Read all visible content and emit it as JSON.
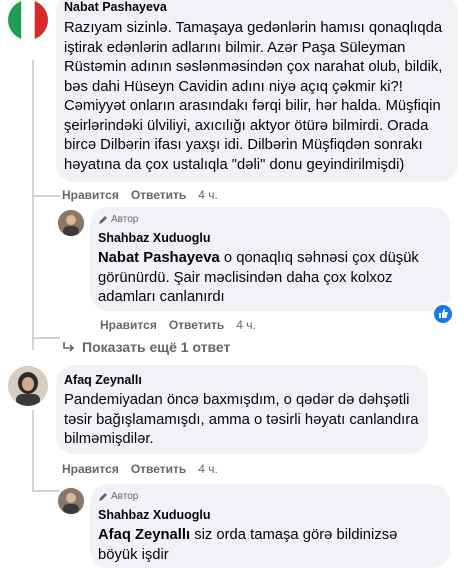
{
  "colors": {
    "bubble": "#f0f2f5",
    "text": "#050505",
    "secondary": "#65676b",
    "like_blue": "#1877f2"
  },
  "comments": [
    {
      "author": "Nabat Pashayeva",
      "text": "Razıyam sizinlə. Tamaşaya gedənlərin hamısı qonaqlıqda iştirak edənlərin adlarını bilmir. Azər Paşa Süleyman Rüstəmin adının səslənməsindən çox narahat olub, bildik, bəs dahi Hüseyn Cavidin adını niyə açıq çəkmir ki?! Cəmiyyət onların arasındakı fərqi bilir, hər halda. Müşfiqin şeirlərindəki ülviliyi, axıcılığı aktyor ötürə bilmirdi. Orada bircə Dilbərin ifası yaxşı idi. Dilbərin Müşfiqdən sonrakı həyatına da çox ustalıqla \"dəli\" donu geyindirilmişdi)",
      "like_label": "Нравится",
      "reply_label": "Ответить",
      "time": "4 ч.",
      "avatar_icon": "italy-flag-avatar"
    },
    {
      "author_badge": "Автор",
      "author": "Shahbaz Xuduoglu",
      "mention": "Nabat Pashayeva",
      "text": " o qonaqlıq səhnəsi çox düşük görünürdü. Şair məclisindən daha çox kolxoz adamları canlanırdı",
      "like_label": "Нравится",
      "reply_label": "Ответить",
      "time": "4 ч.",
      "reaction_icon": "thumbs-up-icon"
    },
    {
      "author": "Afaq Zeynallı",
      "text": "Pandemiyadan öncə baxmışdım, o qədər də dəhşətli təsir bağışlamamışdı, amma o təsirli həyatı canlandıra bilməmişdilər.",
      "like_label": "Нравится",
      "reply_label": "Ответить",
      "time": "4 ч."
    },
    {
      "author_badge": "Автор",
      "author": "Shahbaz Xuduoglu",
      "mention": "Afaq Zeynallı",
      "text": " siz orda tamaşa görə bildinizsə böyük işdir"
    }
  ],
  "show_more": "Показать ещё 1 ответ"
}
